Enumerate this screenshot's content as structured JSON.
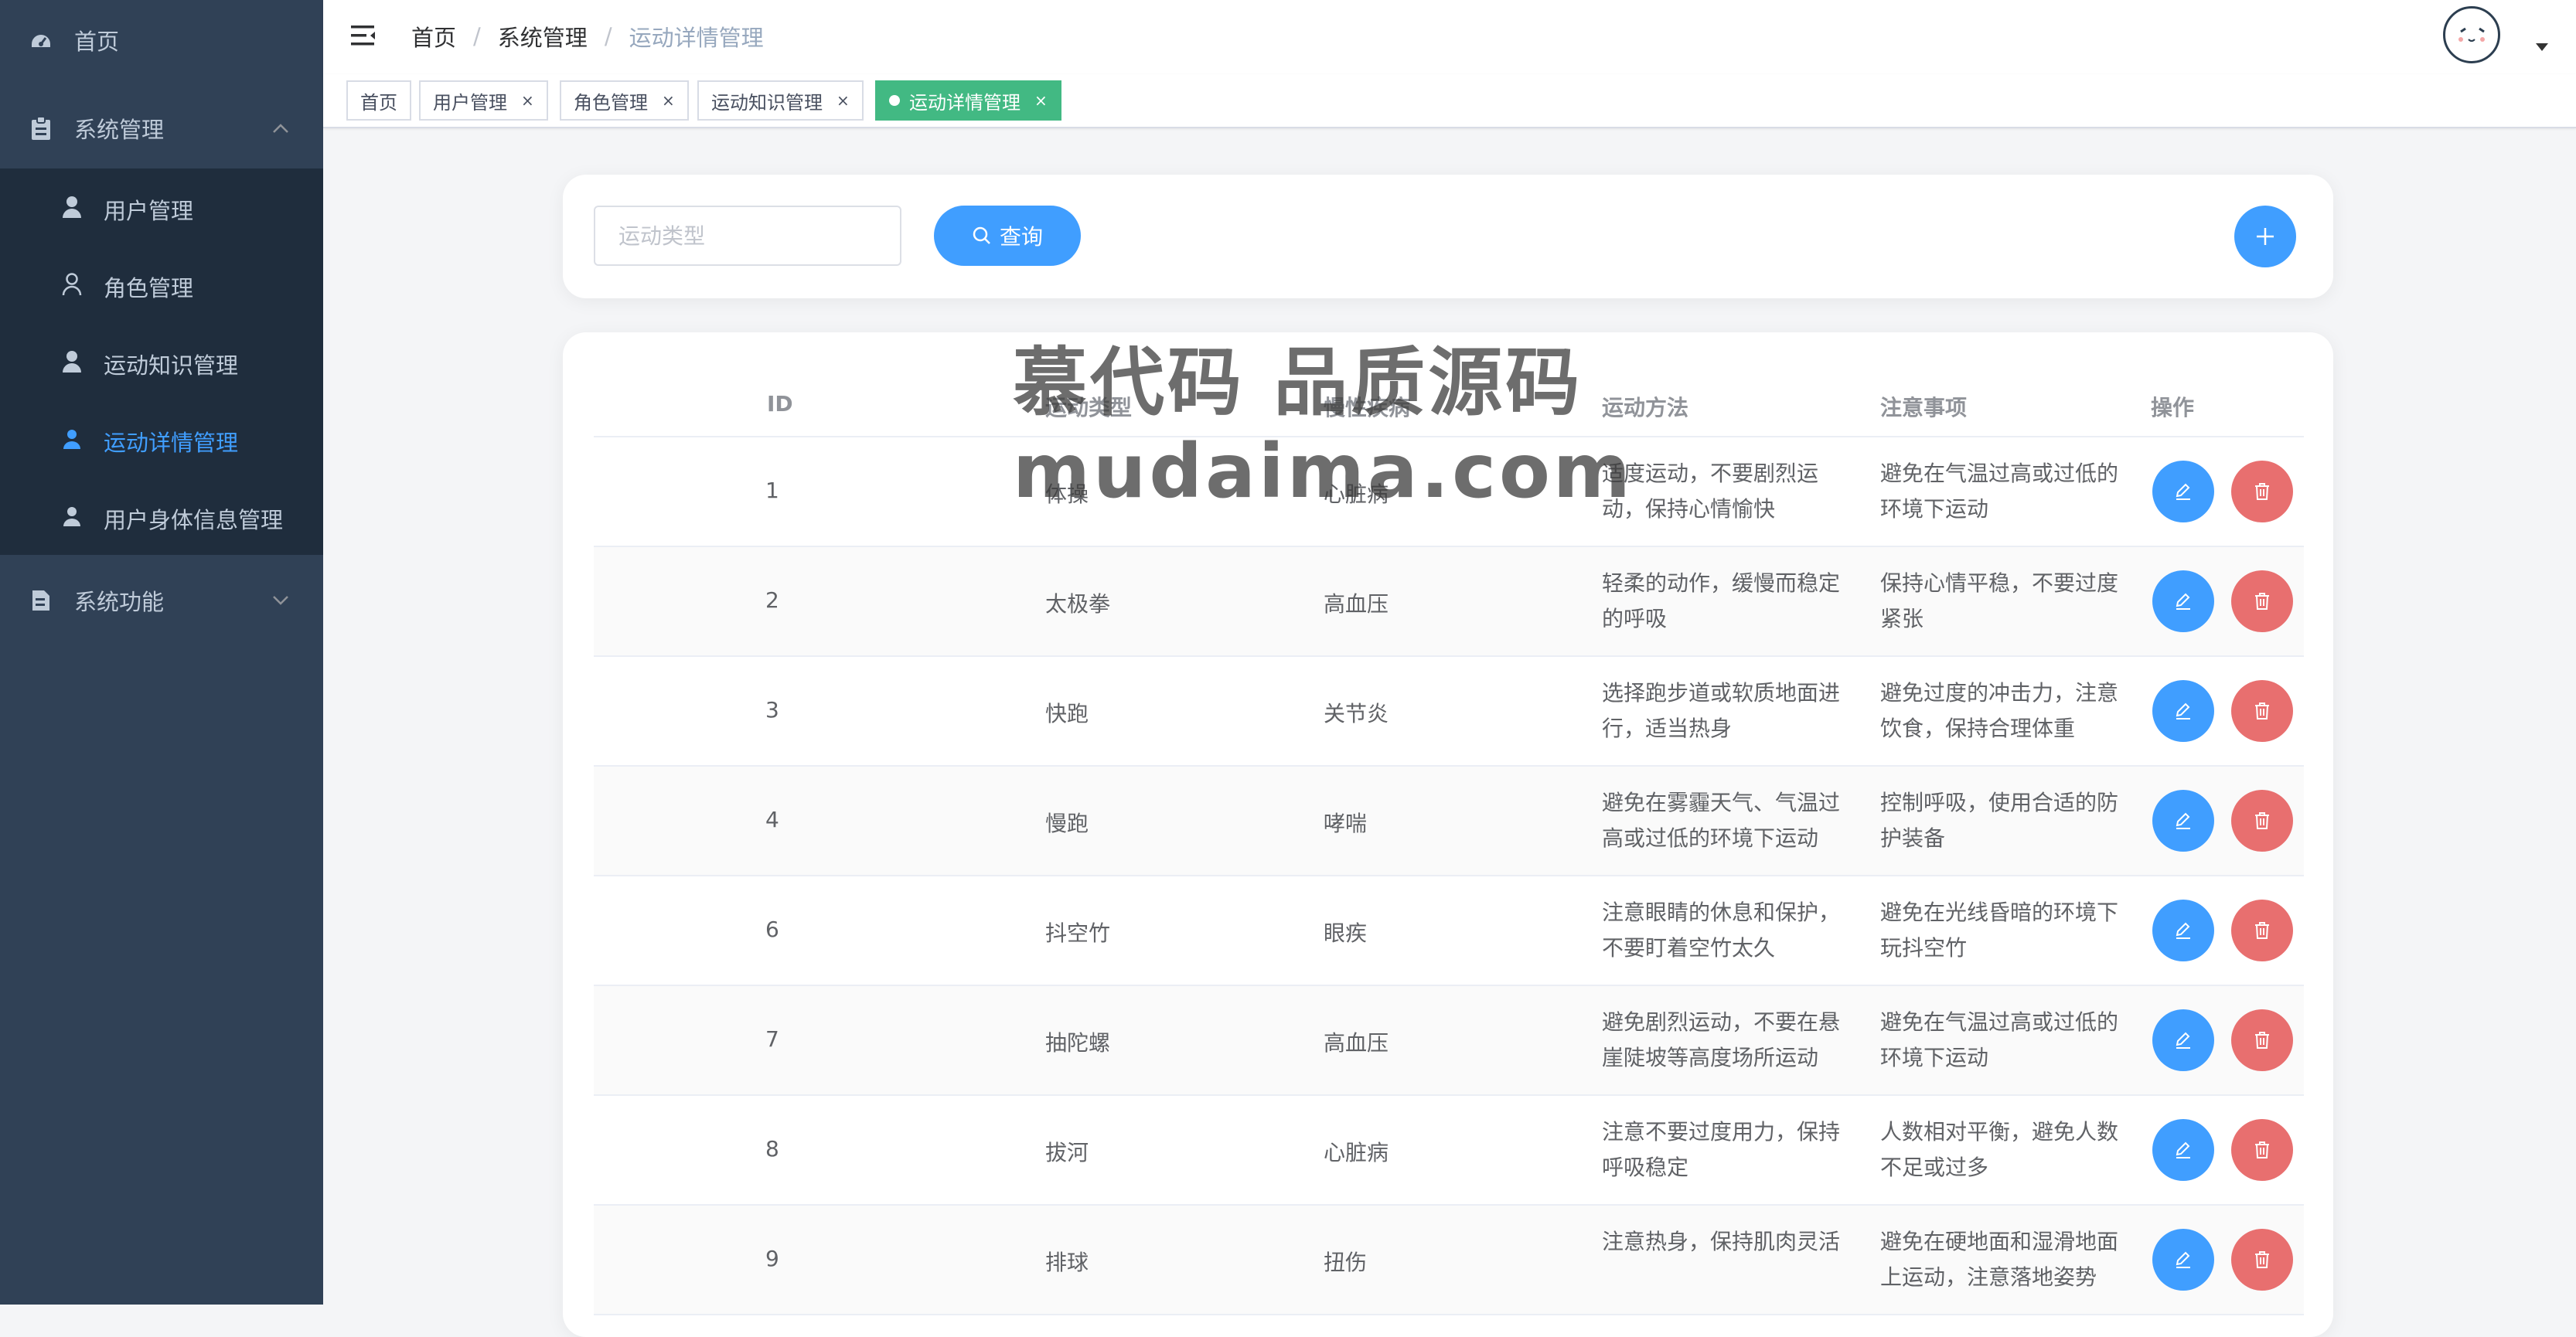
{
  "sidebar": {
    "home": "首页",
    "system_management": "系统管理",
    "sub_items": [
      "用户管理",
      "角色管理",
      "运动知识管理",
      "运动详情管理",
      "用户身体信息管理"
    ],
    "active_index": 3,
    "system_functions": "系统功能"
  },
  "breadcrumb": [
    "首页",
    "系统管理",
    "运动详情管理"
  ],
  "breadcrumb_sep": "/",
  "tags": [
    {
      "label": "首页",
      "closable": false,
      "active": false
    },
    {
      "label": "用户管理",
      "closable": true,
      "active": false
    },
    {
      "label": "角色管理",
      "closable": true,
      "active": false
    },
    {
      "label": "运动知识管理",
      "closable": true,
      "active": false
    },
    {
      "label": "运动详情管理",
      "closable": true,
      "active": true
    }
  ],
  "tag_close": "×",
  "search": {
    "placeholder": "运动类型",
    "query_label": "查询"
  },
  "table": {
    "headers": [
      "ID",
      "运动类型",
      "慢性疾病",
      "运动方法",
      "注意事项",
      "操作"
    ],
    "rows": [
      {
        "id": "1",
        "type": "体操",
        "disease": "心脏病",
        "method": "适度运动，不要剧烈运动，保持心情愉快",
        "notes": "避免在气温过高或过低的环境下运动"
      },
      {
        "id": "2",
        "type": "太极拳",
        "disease": "高血压",
        "method": "轻柔的动作，缓慢而稳定的呼吸",
        "notes": "保持心情平稳，不要过度紧张"
      },
      {
        "id": "3",
        "type": "快跑",
        "disease": "关节炎",
        "method": "选择跑步道或软质地面进行，适当热身",
        "notes": "避免过度的冲击力，注意饮食，保持合理体重"
      },
      {
        "id": "4",
        "type": "慢跑",
        "disease": "哮喘",
        "method": "避免在雾霾天气、气温过高或过低的环境下运动",
        "notes": "控制呼吸，使用合适的防护装备"
      },
      {
        "id": "6",
        "type": "抖空竹",
        "disease": "眼疾",
        "method": "注意眼睛的休息和保护，不要盯着空竹太久",
        "notes": "避免在光线昏暗的环境下玩抖空竹"
      },
      {
        "id": "7",
        "type": "抽陀螺",
        "disease": "高血压",
        "method": "避免剧烈运动，不要在悬崖陡坡等高度场所运动",
        "notes": "避免在气温过高或过低的环境下运动"
      },
      {
        "id": "8",
        "type": "拔河",
        "disease": "心脏病",
        "method": "注意不要过度用力，保持呼吸稳定",
        "notes": "人数相对平衡，避免人数不足或过多"
      },
      {
        "id": "9",
        "type": "排球",
        "disease": "扭伤",
        "method": "注意热身，保持肌肉灵活",
        "notes": "避免在硬地面和湿滑地面上运动，注意落地姿势"
      }
    ]
  },
  "watermark": {
    "line1": "慕代码 品质源码",
    "line2": "mudaima.com"
  },
  "colors": {
    "sidebar_bg": "#304156",
    "submenu_bg": "#1f2d3d",
    "primary": "#409eff",
    "danger": "#e86f6f",
    "active_tag": "#42b983"
  }
}
